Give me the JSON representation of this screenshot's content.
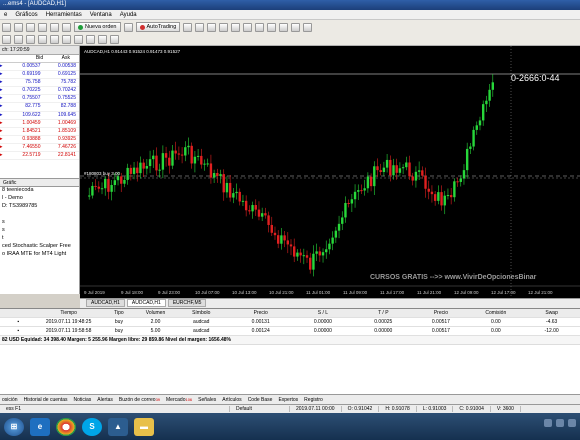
{
  "window": {
    "title": "...ems4 - [AUDCAD,H1]"
  },
  "menu": [
    "e",
    "Gráficos",
    "Herramientas",
    "Ventana",
    "Ayuda"
  ],
  "toolbar": {
    "new_order": "Nueva orden",
    "autotrading": "AutoTrading"
  },
  "market_watch": {
    "header": "ch: 17:20:59",
    "col_bid": "Bid",
    "col_ask": "Ask",
    "rows": [
      {
        "bid": "0.00537",
        "ask": "0.00538",
        "color": "blue"
      },
      {
        "bid": "0.69199",
        "ask": "0.69125",
        "color": "blue"
      },
      {
        "bid": "75.758",
        "ask": "75.782",
        "color": "blue"
      },
      {
        "bid": "0.70225",
        "ask": "0.70242",
        "color": "blue"
      },
      {
        "bid": "0.75507",
        "ask": "0.75525",
        "color": "blue"
      },
      {
        "bid": "82.775",
        "ask": "82.788",
        "color": "blue"
      },
      {
        "bid": "109.622",
        "ask": "109.645",
        "color": "blue"
      },
      {
        "bid": "1.00459",
        "ask": "1.00469",
        "color": "red"
      },
      {
        "bid": "1.84521",
        "ask": "1.85109",
        "color": "red"
      },
      {
        "bid": "0.93888",
        "ask": "0.93925",
        "color": "red"
      },
      {
        "bid": "7.46550",
        "ask": "7.46726",
        "color": "red"
      },
      {
        "bid": "22.5719",
        "ask": "22.8141",
        "color": "red"
      }
    ],
    "tab": "Gráfic"
  },
  "navigator": {
    "lines": [
      "8 teeniecoda",
      "l - Demo",
      "D: TS3989785",
      "",
      "s",
      "s",
      "t",
      "ced Stochastic Scalper Free",
      "o IRAA MTE for MT4 Light"
    ]
  },
  "chart": {
    "info": "AUDCAD,H1  0.91443 0.91524 0.91473 0.91527",
    "price_tag": "0-2666:0-44",
    "level_label": "#180803 buy 3.00",
    "watermark": "CURSOS GRATIS -->> www.VivirDeOpcionesBinar",
    "x_labels": [
      "9 Jul 2019",
      "9 Jul 18:00",
      "9 Jul 23:00",
      "10 Jul 07:00",
      "10 Jul 13:00",
      "10 Jul 21:00",
      "11 Jul 01:00",
      "11 Jul 09:00",
      "11 Jul 17:00",
      "11 Jul 21:00",
      "12 Jul 09:00",
      "12 Jul 17:00",
      "12 Jul 21:00"
    ],
    "tabs": [
      "AUDCAD,H1",
      "AUDCAD,H1",
      "EURCHF,M5"
    ]
  },
  "terminal": {
    "headers": [
      "Tiempo",
      "Tipo",
      "Volumen",
      "Símbolo",
      "Precio",
      "S / L",
      "T / P",
      "Precio",
      "Comisión",
      "Swap"
    ],
    "rows": [
      [
        "2019.07.11 19:48:25",
        "buy",
        "2.00",
        "audcad",
        "0.00131",
        "0.00000",
        "0.00025",
        "0.00517",
        "0.00",
        "-4.63"
      ],
      [
        "2019.07.11 19:58:58",
        "buy",
        "5.00",
        "audcad",
        "0.00124",
        "0.00000",
        "0.00000",
        "0.00517",
        "0.00",
        "-12.00"
      ]
    ],
    "balance": "82 USD  Equidad: 34 398.40  Margen: 5 255.96  Margen libre: 29 859.86  Nivel del margen: 1656.48%",
    "tabs": [
      "osición",
      "Historial de cuentas",
      "Noticias",
      "Alertas",
      "Buzón de correo",
      "Mercado",
      "Señales",
      "Artículos",
      "Code Base",
      "Expertos",
      "Registro"
    ],
    "badges": {
      "mail": "39",
      "market": "106"
    }
  },
  "status": {
    "help": "ess F1",
    "profile": "Default",
    "datetime": "2019.07.11 00:00",
    "o": "O: 0.91042",
    "h": "H: 0.91078",
    "l": "L: 0.91003",
    "c": "C: 0.91004",
    "v": "V: 3600"
  },
  "taskbar": {
    "icons": [
      "windows-icon",
      "ie-icon",
      "chrome-icon",
      "skype-icon",
      "mt4-icon",
      "explorer-icon"
    ]
  }
}
